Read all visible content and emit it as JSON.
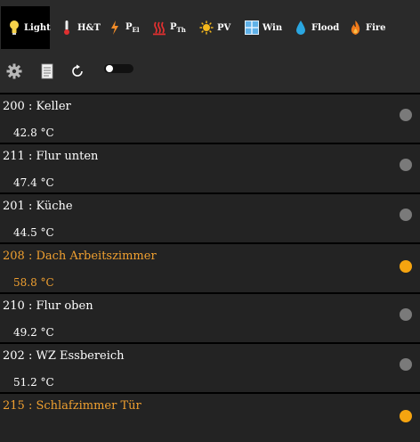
{
  "tabs": [
    {
      "label": "Light",
      "sub": "",
      "icon": "light-bulb-icon"
    },
    {
      "label": "H&T",
      "sub": "",
      "icon": "thermometer-icon"
    },
    {
      "label": "P",
      "sub": "El",
      "icon": "lightning-icon"
    },
    {
      "label": "P",
      "sub": "Th",
      "icon": "heat-icon"
    },
    {
      "label": "PV",
      "sub": "",
      "icon": "sun-icon"
    },
    {
      "label": "Win",
      "sub": "",
      "icon": "window-icon"
    },
    {
      "label": "Flood",
      "sub": "",
      "icon": "water-drop-icon"
    },
    {
      "label": "Fire",
      "sub": "",
      "icon": "fire-icon"
    }
  ],
  "active_tab": "Light",
  "toolbar": {
    "icons": [
      "gear-icon",
      "document-icon",
      "refresh-icon"
    ],
    "toggle_on": false
  },
  "colors": {
    "alert": "#f5a410",
    "normal_dot": "#7a7a7a",
    "header": "#2a2a2a"
  },
  "sensors": [
    {
      "name": "200 : Keller",
      "value": "42.8 °C",
      "alert": false
    },
    {
      "name": "211 : Flur unten",
      "value": "47.4 °C",
      "alert": false
    },
    {
      "name": "201 : Küche",
      "value": "44.5 °C",
      "alert": false
    },
    {
      "name": "208 : Dach Arbeitszimmer",
      "value": "58.8 °C",
      "alert": true
    },
    {
      "name": "210 : Flur oben",
      "value": "49.2 °C",
      "alert": false
    },
    {
      "name": "202 : WZ Essbereich",
      "value": "51.2 °C",
      "alert": false
    },
    {
      "name": "215 : Schlafzimmer Tür",
      "value": "",
      "alert": true
    }
  ]
}
